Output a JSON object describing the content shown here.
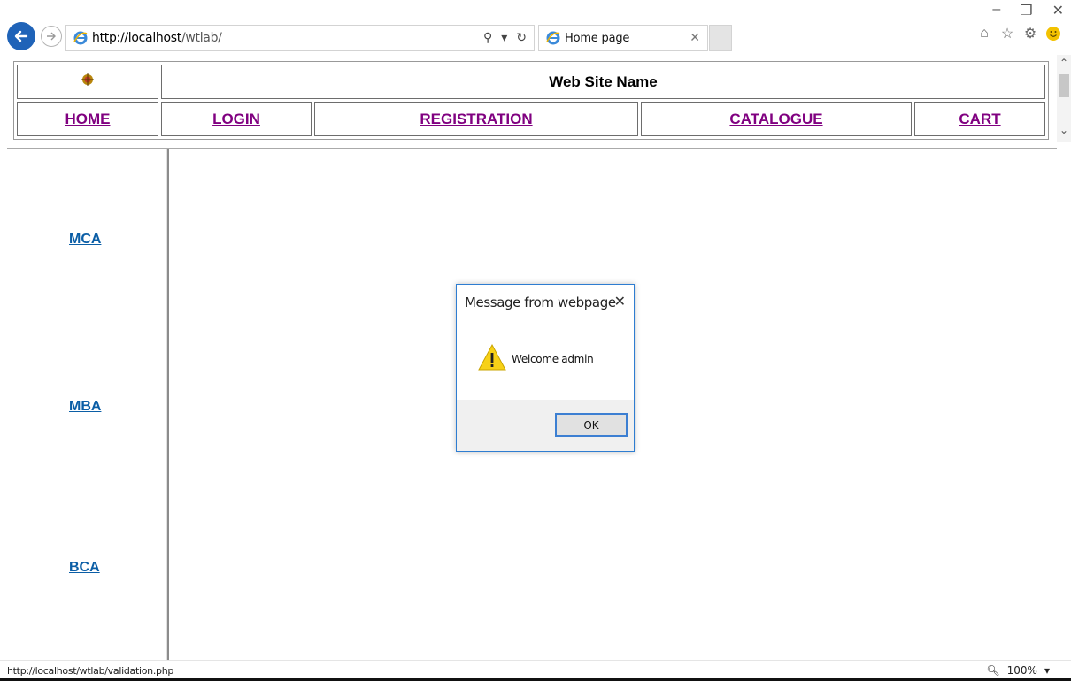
{
  "browser": {
    "url_host": "http://localhost",
    "url_path": "/wtlab/",
    "tab_title": "Home page",
    "status_url": "http://localhost/wtlab/validation.php",
    "zoom_level": "100%"
  },
  "header": {
    "site_name": "Web Site Name",
    "nav": {
      "home": "HOME",
      "login": "LOGIN",
      "registration": "REGISTRATION",
      "catalogue": "CATALOGUE",
      "cart": "CART"
    }
  },
  "sidebar": {
    "items": [
      {
        "label": "MCA"
      },
      {
        "label": "MBA"
      },
      {
        "label": "BCA"
      }
    ]
  },
  "dialog": {
    "title": "Message from webpage",
    "message": "Welcome admin",
    "ok_label": "OK"
  },
  "colors": {
    "nav_link": "#800080",
    "side_link": "#0b5ea6",
    "dialog_border": "#2e7dd1",
    "back_button": "#1f63b8"
  }
}
